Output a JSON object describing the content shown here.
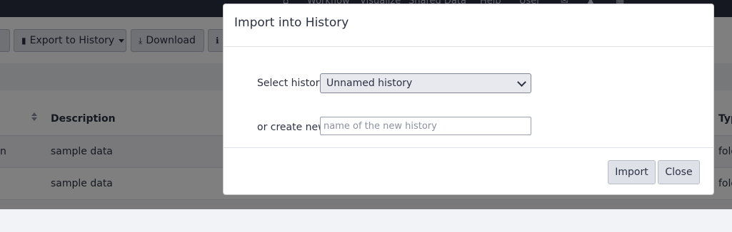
{
  "navbar": {
    "items": [
      "Workflow",
      "Visualize",
      "Shared Data",
      "Help",
      "User"
    ]
  },
  "toolbar": {
    "export_label": "Export to History",
    "download_label": "Download"
  },
  "table": {
    "headers": {
      "description": "Description",
      "type": "Typ"
    },
    "rows": [
      {
        "name_fragment": "n",
        "description": "sample data",
        "type": "fold"
      },
      {
        "name_fragment": "",
        "description": "sample data",
        "type": "fold"
      }
    ]
  },
  "modal": {
    "title": "Import into History",
    "select_history_label": "Select history:",
    "selected_history": "Unnamed history",
    "create_new_label": "or create new:",
    "new_history_placeholder": "name of the new history",
    "import_label": "Import",
    "close_label": "Close"
  },
  "icons": {
    "export": "book-icon",
    "download": "download-icon",
    "info": "info-icon",
    "mail": "envelope-icon",
    "notifications": "bell-icon",
    "apps": "grid-icon",
    "home": "home-icon"
  },
  "colors": {
    "navbar": "#2c3143",
    "button": "#dee2e8",
    "backdrop": "rgba(0,0,0,0.5)"
  }
}
